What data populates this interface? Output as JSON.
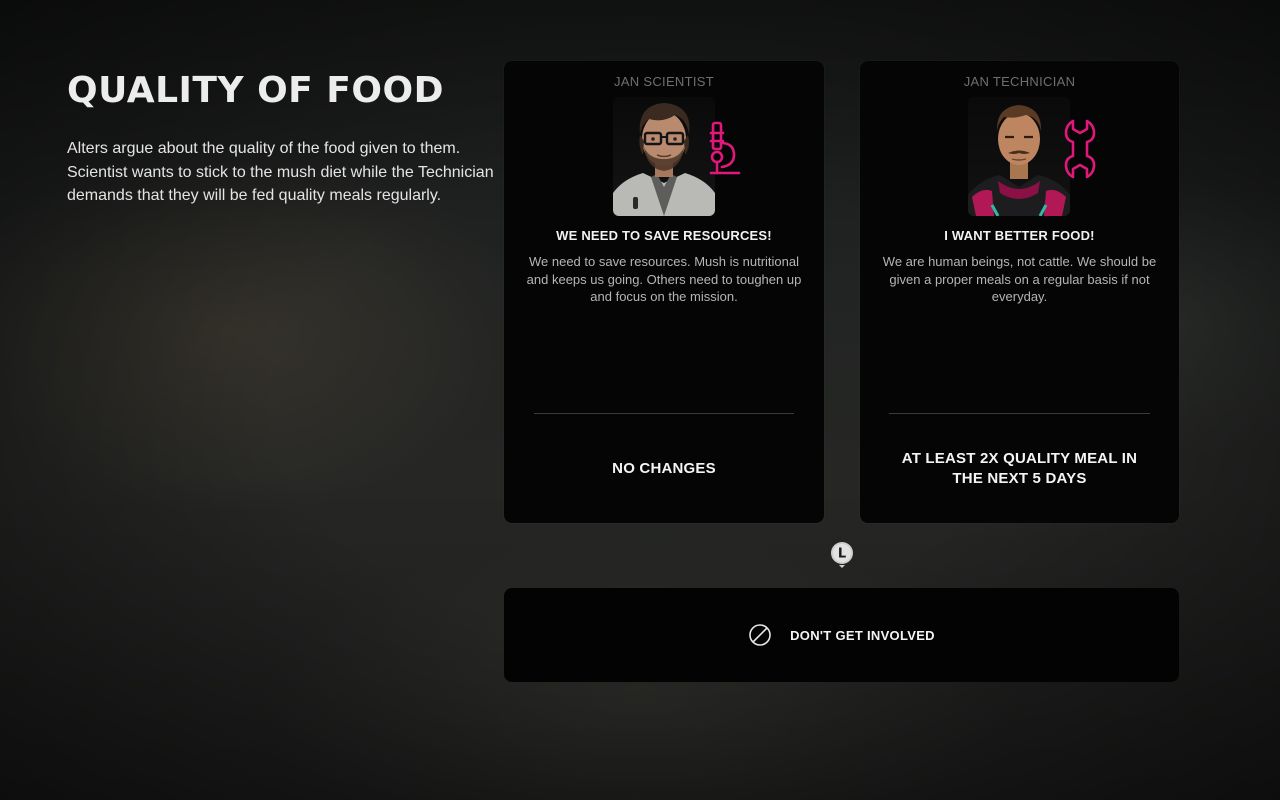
{
  "event": {
    "title": "QUALITY OF FOOD",
    "description": "Alters argue about the quality of the food given to them.\nScientist wants to stick to the mush diet while the Technician\ndemands that they will be fed quality meals regularly."
  },
  "choices": [
    {
      "name": "JAN SCIENTIST",
      "role_icon": "microscope-icon",
      "heading": "WE NEED TO SAVE RESOURCES!",
      "body": "We need to save resources. Mush is nutritional and keeps us going. Others need to toughen up and focus on the mission.",
      "outcome": "NO CHANGES"
    },
    {
      "name": "JAN TECHNICIAN",
      "role_icon": "wrench-icon",
      "heading": "I WANT BETTER FOOD!",
      "body": "We are human beings, not cattle. We should be given a proper meals on a regular basis if not everyday.",
      "outcome": "AT LEAST 2X QUALITY MEAL IN THE NEXT 5 DAYS"
    }
  ],
  "input_hint": {
    "key": "L",
    "icon": "controller-left-stick-icon"
  },
  "neutral_option": {
    "label": "DON'T GET INVOLVED",
    "icon": "ban-icon"
  },
  "colors": {
    "accent_pink": "#e0187a",
    "card_bg": "#050505",
    "name_gray": "#6f6f6f"
  }
}
